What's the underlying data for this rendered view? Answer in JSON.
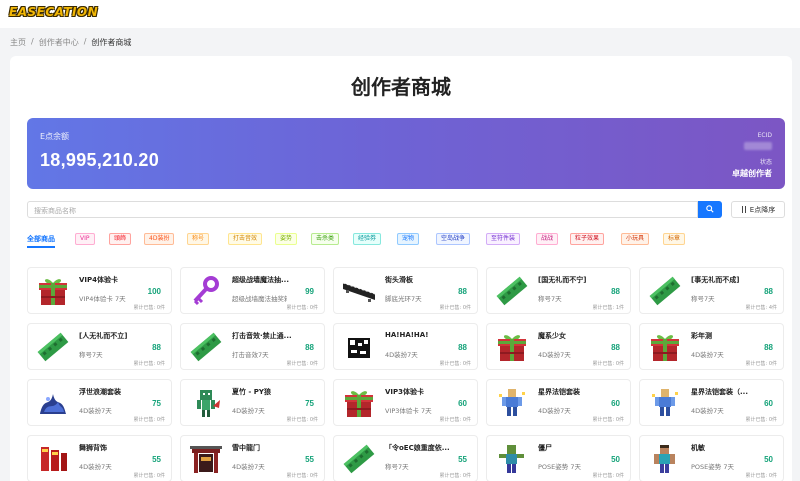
{
  "app": {
    "logo_text": "EASECATION"
  },
  "breadcrumb": {
    "home": "主页",
    "sep1": "/",
    "center": "创作者中心",
    "sep2": "/",
    "current": "创作者商城"
  },
  "page": {
    "title": "创作者商城"
  },
  "banner": {
    "balance_label": "E点余额",
    "balance": "18,995,210.20",
    "ecid_label": "ECID",
    "status_label": "状态",
    "status_value": "卓越创作者"
  },
  "search": {
    "placeholder": "搜索商品名称",
    "sort_label": "E点降序"
  },
  "categories": {
    "all": "全部商品",
    "tags": [
      {
        "label": "VIP",
        "color": "#eb2f96",
        "bg": "#fff0f6",
        "border": "#ffadd2"
      },
      {
        "label": "頭飾",
        "color": "#f5222d",
        "bg": "#fff1f0",
        "border": "#ffa39e"
      },
      {
        "label": "4D装扮",
        "color": "#fa541c",
        "bg": "#fff2e8",
        "border": "#ffbb96"
      },
      {
        "label": "称号",
        "color": "#fa8c16",
        "bg": "#fff7e6",
        "border": "#ffd591"
      },
      {
        "label": "打击音效",
        "color": "#d48806",
        "bg": "#fffbe6",
        "border": "#ffe58f"
      },
      {
        "label": "姿势",
        "color": "#7cb305",
        "bg": "#fcffe6",
        "border": "#eaff8f"
      },
      {
        "label": "击杀类",
        "color": "#389e0d",
        "bg": "#f6ffed",
        "border": "#b7eb8f"
      },
      {
        "label": "经验券",
        "color": "#08979c",
        "bg": "#e6fffb",
        "border": "#87e8de"
      },
      {
        "label": "宠物",
        "color": "#1677ff",
        "bg": "#e6f4ff",
        "border": "#91caff"
      },
      {
        "label": "空岛战争",
        "color": "#1d39c4",
        "bg": "#f0f5ff",
        "border": "#adc6ff"
      },
      {
        "label": "至符件装",
        "color": "#722ed1",
        "bg": "#f9f0ff",
        "border": "#d3adf7"
      },
      {
        "label": "战战",
        "color": "#c41d7f",
        "bg": "#fff0f6",
        "border": "#ffadd2"
      },
      {
        "label": "粒子效果",
        "color": "#cf1322",
        "bg": "#fff1f0",
        "border": "#ffa39e"
      },
      {
        "label": "小玩具",
        "color": "#d4380d",
        "bg": "#fff2e8",
        "border": "#ffbb96"
      },
      {
        "label": "标章",
        "color": "#d46b08",
        "bg": "#fff7e6",
        "border": "#ffd591"
      }
    ]
  },
  "sold_prefix": "累计已售: ",
  "products": [
    {
      "name": "VIP4体验卡",
      "sub": "VIP4体验卡 7天",
      "price": "100",
      "sold": "0件",
      "icon": "gift-box-icon"
    },
    {
      "name": "超级战墙魔法抽...",
      "sub": "超级战墙魔法抽奖箱",
      "price": "99",
      "sold": "0件",
      "icon": "purple-key-icon"
    },
    {
      "name": "街头滑板",
      "sub": "脚底光环7天",
      "price": "88",
      "sold": "0件",
      "icon": "skateboard-icon"
    },
    {
      "name": "[国无礼而不宁]",
      "sub": "称号7天",
      "price": "88",
      "sold": "1件",
      "icon": "green-ticket-icon"
    },
    {
      "name": "[事无礼而不成]",
      "sub": "称号7天",
      "price": "88",
      "sold": "4件",
      "icon": "green-ticket-icon"
    },
    {
      "name": "[人无礼而不立]",
      "sub": "称号7天",
      "price": "88",
      "sold": "0件",
      "icon": "green-ticket-icon"
    },
    {
      "name": "打击音效·禁止通...",
      "sub": "打击音效7天",
      "price": "88",
      "sold": "0件",
      "icon": "green-ticket-icon"
    },
    {
      "name": "HA!HA!HA!",
      "sub": "4D装扮7天",
      "price": "88",
      "sold": "0件",
      "icon": "haha-sign-icon"
    },
    {
      "name": "魔系少女",
      "sub": "4D装扮7天",
      "price": "88",
      "sold": "0件",
      "icon": "gift-box-icon"
    },
    {
      "name": "彩年测",
      "sub": "4D装扮7天",
      "price": "88",
      "sold": "0件",
      "icon": "gift-box-icon"
    },
    {
      "name": "浮世浪潮套装",
      "sub": "4D装扮7天",
      "price": "75",
      "sold": "0件",
      "icon": "wave-costume-icon"
    },
    {
      "name": "夏竹 - PY狼",
      "sub": "4D装扮7天",
      "price": "75",
      "sold": "0件",
      "icon": "wolf-costume-icon"
    },
    {
      "name": "VIP3体验卡",
      "sub": "VIP3体验卡 7天",
      "price": "60",
      "sold": "0件",
      "icon": "gift-box-icon"
    },
    {
      "name": "星界法铠套装",
      "sub": "4D装扮7天",
      "price": "60",
      "sold": "0件",
      "icon": "armor-figure-icon"
    },
    {
      "name": "星界法铠套装（...",
      "sub": "4D装扮7天",
      "price": "60",
      "sold": "0件",
      "icon": "armor-figure-icon"
    },
    {
      "name": "舞狮背饰",
      "sub": "4D装扮7天",
      "price": "55",
      "sold": "0件",
      "icon": "lion-dance-icon"
    },
    {
      "name": "雪中龍门",
      "sub": "4D装扮7天",
      "price": "55",
      "sold": "0件",
      "icon": "dragon-gate-icon"
    },
    {
      "name": "「令oEC娘重度依...",
      "sub": "称号7天",
      "price": "55",
      "sold": "0件",
      "icon": "green-ticket-icon"
    },
    {
      "name": "僵尸",
      "sub": "POSE姿势 7天",
      "price": "50",
      "sold": "0件",
      "icon": "zombie-figure-icon"
    },
    {
      "name": "机敏",
      "sub": "POSE姿势 7天",
      "price": "50",
      "sold": "0件",
      "icon": "steve-figure-icon"
    }
  ]
}
